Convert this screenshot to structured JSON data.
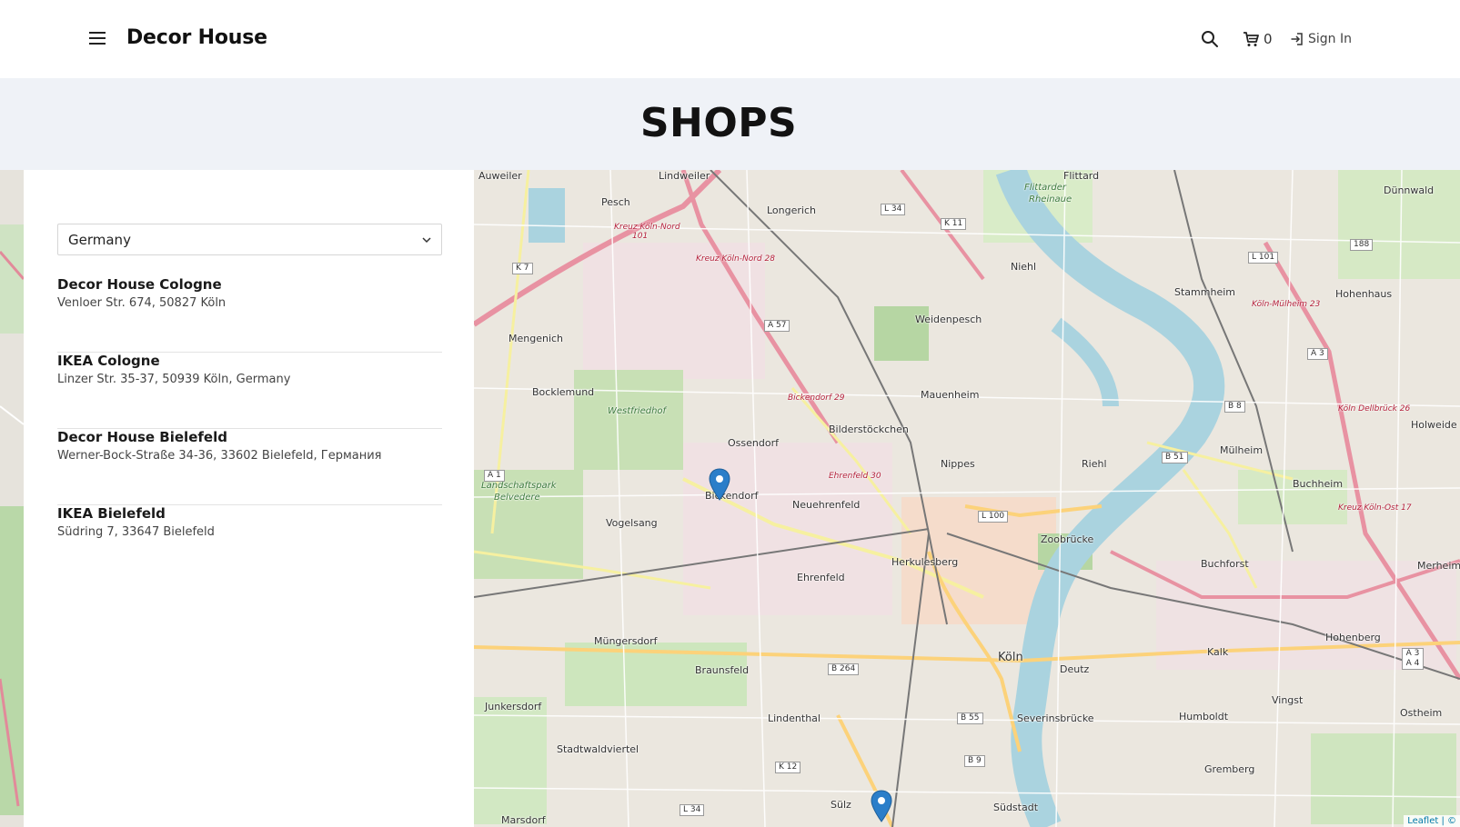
{
  "header": {
    "brand": "Decor House",
    "cart_count": "0",
    "signin_label": "Sign In"
  },
  "hero": {
    "title": "SHOPS"
  },
  "filter": {
    "country_value": "Germany"
  },
  "shops": [
    {
      "name": "Decor House Cologne",
      "address": "Venloer Str. 674, 50827 Köln"
    },
    {
      "name": "IKEA Cologne",
      "address": "Linzer Str. 35-37, 50939 Köln, Germany"
    },
    {
      "name": "Decor House Bielefeld",
      "address": "Werner-Bock-Straße 34-36, 33602 Bielefeld, Германия"
    },
    {
      "name": "IKEA Bielefeld",
      "address": "Südring 7, 33647 Bielefeld"
    }
  ],
  "map": {
    "attribution": "Leaflet | ©",
    "places": {
      "auweiler": "Auweiler",
      "lindweiler": "Lindweiler",
      "flittard": "Flittard",
      "dunnwald": "Dünnwald",
      "pesch": "Pesch",
      "longerich": "Longerich",
      "niehl": "Niehl",
      "stammheim": "Stammheim",
      "hohenhaus": "Hohenhaus",
      "mengenich": "Mengenich",
      "weidenpesch": "Weidenpesch",
      "bocklemund": "Bocklemund",
      "mauenheim": "Mauenheim",
      "bilderstockchen": "Bilderstöckchen",
      "ossendorf": "Ossendorf",
      "nippes": "Nippes",
      "riehl": "Riehl",
      "mulheim": "Mülheim",
      "holweide": "Holweide",
      "buchheim": "Buchheim",
      "bickendorf": "Bickendorf",
      "neuehrenfeld": "Neuehrenfeld",
      "vogelsang": "Vogelsang",
      "ehrenfeld": "Ehrenfeld",
      "buchforst": "Buchforst",
      "merheim": "Merheim",
      "mungersdorf": "Müngersdorf",
      "braunsfeld": "Braunsfeld",
      "koln": "Köln",
      "deutz": "Deutz",
      "kalk": "Kalk",
      "hohenberg": "Hohenberg",
      "junkersdorf": "Junkersdorf",
      "lindenthal": "Lindenthal",
      "vingst": "Vingst",
      "ostheim": "Ostheim",
      "humboldt": "Humboldt",
      "stadtwaldviertel": "Stadtwaldviertel",
      "gremberg": "Gremberg",
      "marsdorf": "Marsdorf",
      "sulz": "Sülz",
      "sudstadt": "Südstadt",
      "zoobrucke": "Zoobrücke",
      "severinsbrucke": "Severinsbrücke",
      "herkulesberg": "Herkulesberg",
      "westfriedhof": "Westfriedhof",
      "landschaftspark": "Landschaftspark",
      "belvedere": "Belvedere",
      "fittarder": "Flittarder",
      "rheinaue": "Rheinaue"
    },
    "roads": {
      "l34": "L 34",
      "k11": "K 11",
      "k7": "K 7",
      "l101": "L 101",
      "a57": "A 57",
      "a3": "A 3",
      "b8": "B 8",
      "b51": "B 51",
      "a1": "A 1",
      "l100": "L 100",
      "b264": "B 264",
      "b55": "B 55",
      "k12": "K 12",
      "b9": "B 9",
      "l34b": "L 34",
      "a34": "A 3 A 4",
      "n188": "188"
    },
    "exits": {
      "kkn": "Kreuz Köln-Nord",
      "kkn101": "101",
      "kkn28": "Kreuz Köln-Nord 28",
      "bickendorf29": "Bickendorf 29",
      "ehrenfeld30": "Ehrenfeld 30",
      "kolnmulheim": "Köln-Mülheim 23",
      "dellbruck": "Köln Dellbrück 26",
      "kolnost": "Kreuz Köln-Ost 17"
    }
  }
}
